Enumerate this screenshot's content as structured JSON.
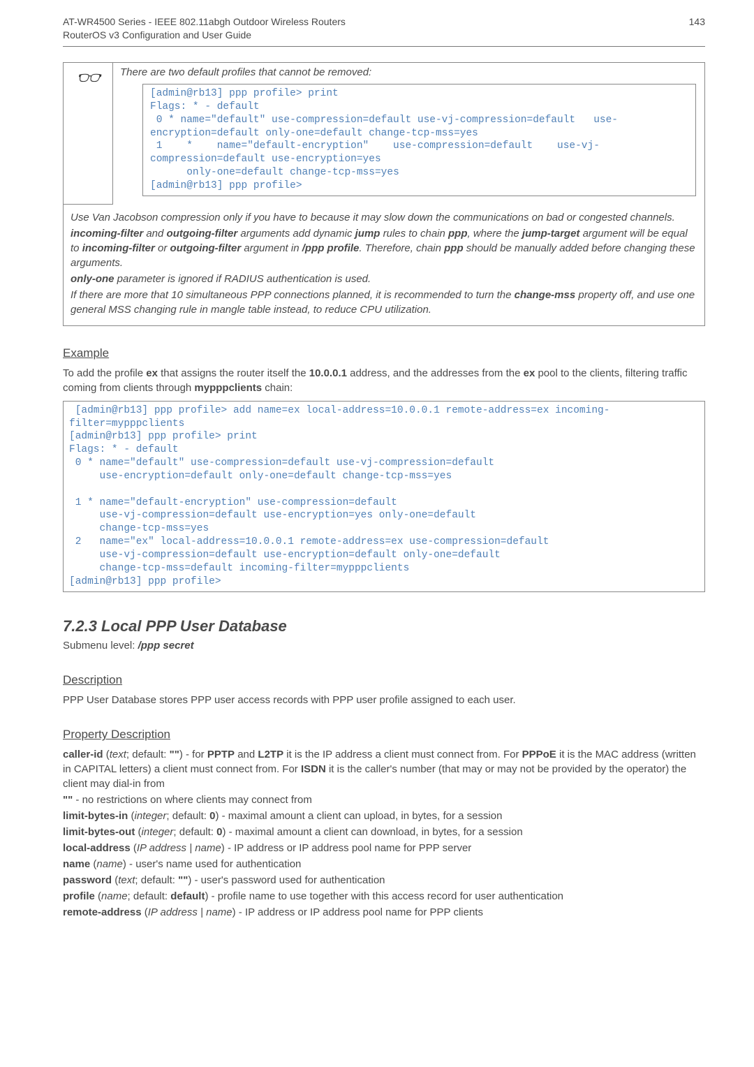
{
  "header": {
    "title_line1": "AT-WR4500 Series - IEEE 802.11abgh Outdoor Wireless Routers",
    "title_line2": "RouterOS v3 Configuration and User Guide",
    "page_number": "143"
  },
  "note_box": {
    "icon": "☞",
    "intro": "There are two default profiles that cannot be removed:",
    "code": "[admin@rb13] ppp profile> print\nFlags: * - default\n 0 * name=\"default\" use-compression=default use-vj-compression=default   use-encryption=default only-one=default change-tcp-mss=yes\n 1    *    name=\"default-encryption\"    use-compression=default    use-vj-compression=default use-encryption=yes\n      only-one=default change-tcp-mss=yes\n[admin@rb13] ppp profile>",
    "para1_a": "Use Van Jacobson compression only if you have to because it may slow down the communications on bad or congested channels.",
    "para2_pre": "",
    "incoming_filter": "incoming-filter",
    "and_txt": " and ",
    "outgoing_filter": "outgoing-filter",
    "para2_mid": " arguments add dynamic ",
    "jump": "jump",
    "para2_mid2": " rules to chain ",
    "ppp": "ppp",
    "para2_post": ", where the ",
    "jump_target": "jump-target",
    "para3_a": " argument will be equal to ",
    "or_txt": " or ",
    "para3_b": " argument in ",
    "ppp_profile": "/ppp profile",
    "para3_c": ". Therefore, chain ",
    "para3_d": " should be manually added before changing these arguments.",
    "only_one": "only-one",
    "para4": " parameter is ignored if RADIUS authentication is used.",
    "para5_a": "If there are more that 10 simultaneous PPP connections planned, it is recommended to turn the ",
    "change_mss": "change-mss",
    "para5_b": " property off, and use one general MSS changing rule in mangle table instead, to reduce CPU utilization."
  },
  "example": {
    "heading": "Example",
    "intro_a": "To add the profile ",
    "ex": "ex",
    "intro_b": " that assigns the router itself the ",
    "ip": "10.0.0.1",
    "intro_c": " address, and the addresses from the ",
    "intro_d": " pool to the clients, filtering traffic coming from clients through ",
    "chain": "mypppclients",
    "intro_e": " chain:",
    "code": " [admin@rb13] ppp profile> add name=ex local-address=10.0.0.1 remote-address=ex incoming-filter=mypppclients\n[admin@rb13] ppp profile> print\nFlags: * - default\n 0 * name=\"default\" use-compression=default use-vj-compression=default\n     use-encryption=default only-one=default change-tcp-mss=yes\n\n 1 * name=\"default-encryption\" use-compression=default\n     use-vj-compression=default use-encryption=yes only-one=default\n     change-tcp-mss=yes\n 2   name=\"ex\" local-address=10.0.0.1 remote-address=ex use-compression=default\n     use-vj-compression=default use-encryption=default only-one=default\n     change-tcp-mss=default incoming-filter=mypppclients\n[admin@rb13] ppp profile>"
  },
  "subsection": {
    "title": "7.2.3  Local PPP User Database",
    "submenu_label": "Submenu level: ",
    "submenu_value": "/ppp secret"
  },
  "description": {
    "heading": "Description",
    "text": "PPP User Database stores PPP user access records with PPP user profile assigned to each user."
  },
  "properties": {
    "heading": "Property Description",
    "caller_id_name": "caller-id",
    "caller_id_a": " (",
    "text_it": "text",
    "caller_id_def": "; default: ",
    "empty": "\"\"",
    "caller_id_b": ") - for ",
    "pptp": "PPTP",
    "and": " and ",
    "l2tp": "L2TP",
    "caller_id_c": " it is the IP address a client must connect from. For ",
    "pppoe": "PPPoE",
    "caller_id_d": " it is the MAC address (written in CAPITAL letters) a client must connect from. For ",
    "isdn": "ISDN",
    "caller_id_e": " it is the caller's number (that may or may not be provided by the operator) the client may dial-in from",
    "empty_line": " - no restrictions on where clients may connect from",
    "limit_in_name": "limit-bytes-in",
    "int_it": "integer",
    "zero": "0",
    "limit_in_txt": ") - maximal amount a client can upload, in bytes, for a session",
    "limit_out_name": "limit-bytes-out",
    "limit_out_txt": ") - maximal amount a client can download, in bytes, for a session",
    "local_addr_name": "local-address",
    "ipname_it": "IP address | name",
    "local_addr_txt": ") - IP address or IP address pool name for PPP server",
    "name_name": "name",
    "name_it": "name",
    "name_txt": ") - user's name used for authentication",
    "pwd_name": "password",
    "pwd_txt": ") - user's password used for authentication",
    "profile_name": "profile",
    "default": "default",
    "profile_txt": ") - profile name to use together with this access record for user authentication",
    "remote_name": "remote-address",
    "remote_txt": ") - IP address or IP address pool name for PPP clients"
  }
}
